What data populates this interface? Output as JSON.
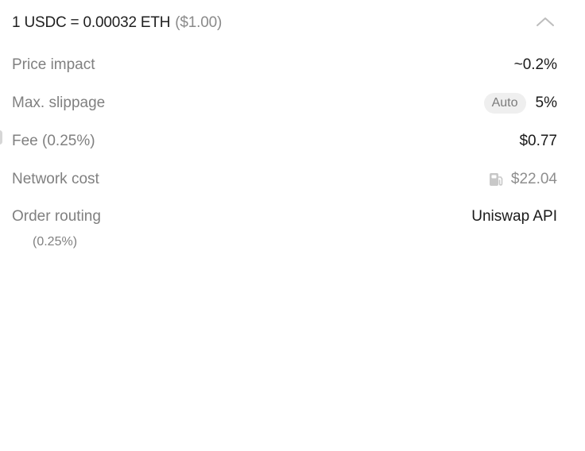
{
  "header": {
    "rate_text": "1 USDC = 0.00032 ETH",
    "rate_usd": "($1.00)",
    "collapse_icon": "chevron-up-icon"
  },
  "rows": {
    "price_impact": {
      "label": "Price impact",
      "value": "~0.2%"
    },
    "max_slippage": {
      "label": "Max. slippage",
      "auto_label": "Auto",
      "value": "5%"
    },
    "fee": {
      "label": "Fee (0.25%)",
      "value": "$0.77"
    },
    "network_cost": {
      "label": "Network cost",
      "icon": "gas-pump-icon",
      "value": "$22.04"
    },
    "order_routing": {
      "label": "Order routing",
      "value": "Uniswap API",
      "note": "(0.25%)"
    }
  },
  "colors": {
    "label": "#808080",
    "value": "#1a1a1a",
    "muted": "#8e8e8e",
    "pill_bg": "#efefef"
  }
}
